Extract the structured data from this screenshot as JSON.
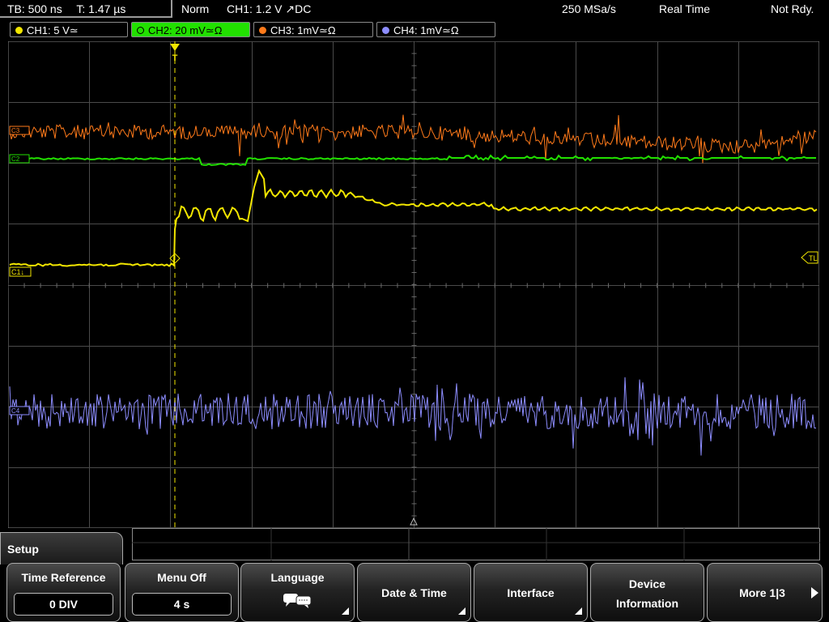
{
  "status": {
    "timebase": "TB: 500 ns",
    "trigger_time": "T: 1.47 µs",
    "trigger_mode": "Norm",
    "trigger_info": "CH1: 1.2 V ↗DC",
    "sample_rate": "250 MSa/s",
    "acq_mode": "Real Time",
    "ready_state": "Not Rdy."
  },
  "channels": [
    {
      "label": "CH1: 5 V≃",
      "color": "#f2e600"
    },
    {
      "label": "CH2: 20 mV≃Ω",
      "color": "#22e000"
    },
    {
      "label": "CH3: 1mV≃Ω",
      "color": "#ff7a1a"
    },
    {
      "label": "CH4: 1mV≃Ω",
      "color": "#8d8dff"
    }
  ],
  "markers": {
    "trigger_pos": "T",
    "trigger_level": "TL",
    "ch1": "C1↓",
    "ch2": "C2",
    "ch3": "C3",
    "ch4": "C4"
  },
  "menu": {
    "title": "Setup",
    "keys": [
      {
        "label": "Time Reference",
        "value": "0 DIV"
      },
      {
        "label": "Menu Off",
        "value": "4 s"
      },
      {
        "label": "Language"
      },
      {
        "label": "Date & Time"
      },
      {
        "label": "Interface"
      },
      {
        "label_line1": "Device",
        "label_line2": "Information"
      },
      {
        "label": "More 1|3"
      }
    ]
  },
  "colors": {
    "ch1": "#f2e600",
    "ch2": "#22e000",
    "ch3": "#ff7a1a",
    "ch4": "#8d8dff",
    "grid": "#4a4a4a"
  }
}
